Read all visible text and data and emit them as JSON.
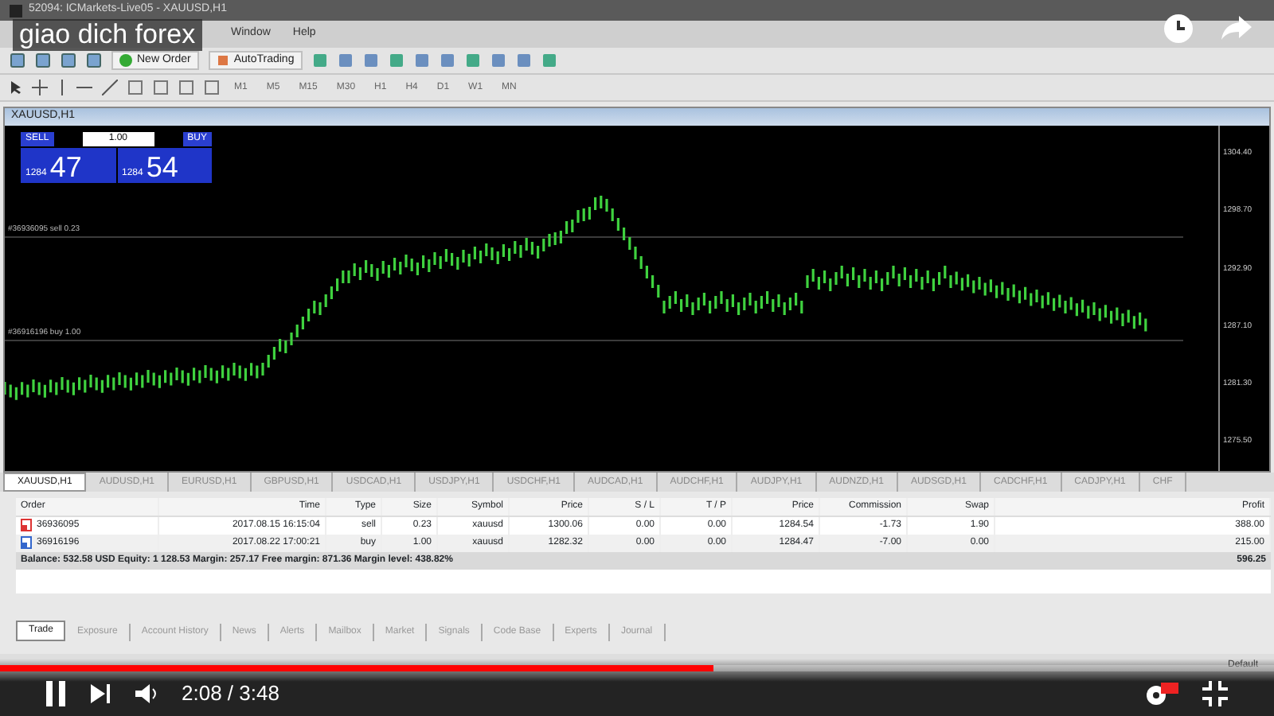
{
  "video": {
    "title": "giao dich forex",
    "progress": {
      "level": 0.56
    },
    "time": "2:08 / 3:48"
  },
  "window": {
    "title": "52094: ICMarkets-Live05 - XAUUSD,H1"
  },
  "menu": [
    "Window",
    "Help"
  ],
  "toolbar": {
    "buttons": [
      {
        "label": "New Order"
      },
      {
        "label": "AutoTrading"
      }
    ],
    "timeframes": [
      "M1",
      "M5",
      "M15",
      "M30",
      "H1",
      "H4",
      "D1",
      "W1",
      "MN"
    ]
  },
  "chart": {
    "title": "XAUUSD,H1",
    "one_click": {
      "sell": "SELL",
      "buy": "BUY",
      "volume": "1.00",
      "bid_big": "1284",
      "bid_small": "47",
      "ask_big": "1284",
      "ask_small": "54"
    },
    "order_lines": [
      "#36936095 sell 0.23",
      "#36916196 buy 1.00"
    ],
    "price_axis": [
      "1304.40",
      "1298.70",
      "1292.90",
      "1287.10",
      "1281.30",
      "1275.50"
    ]
  },
  "symbol_tabs": [
    {
      "label": "XAUUSD,H1",
      "selected": true
    },
    {
      "label": "AUDUSD,H1",
      "selected": false
    },
    {
      "label": "EURUSD,H1",
      "selected": false
    },
    {
      "label": "GBPUSD,H1",
      "selected": false
    },
    {
      "label": "USDCAD,H1",
      "selected": false
    },
    {
      "label": "USDJPY,H1",
      "selected": false
    },
    {
      "label": "USDCHF,H1",
      "selected": false
    },
    {
      "label": "AUDCAD,H1",
      "selected": false
    },
    {
      "label": "AUDCHF,H1",
      "selected": false
    },
    {
      "label": "AUDJPY,H1",
      "selected": false
    },
    {
      "label": "AUDNZD,H1",
      "selected": false
    },
    {
      "label": "AUDSGD,H1",
      "selected": false
    },
    {
      "label": "CADCHF,H1",
      "selected": false
    },
    {
      "label": "CADJPY,H1",
      "selected": false
    },
    {
      "label": "CHF",
      "selected": false
    }
  ],
  "table": {
    "columns": [
      "Order",
      "Time",
      "Type",
      "Size",
      "Symbol",
      "Price",
      "S / L",
      "T / P",
      "Price",
      "Commission",
      "Swap",
      "Profit"
    ],
    "rows": [
      {
        "kind": "sell",
        "cells": [
          "36936095",
          "2017.08.15 16:15:04",
          "sell",
          "0.23",
          "xauusd",
          "1300.06",
          "0.00",
          "0.00",
          "1284.54",
          "-1.73",
          "1.90",
          "388.00"
        ]
      },
      {
        "kind": "buy",
        "cells": [
          "36916196",
          "2017.08.22 17:00:21",
          "buy",
          "1.00",
          "xauusd",
          "1282.32",
          "0.00",
          "0.00",
          "1284.47",
          "-7.00",
          "0.00",
          "215.00"
        ]
      }
    ],
    "summary": {
      "text": "Balance: 532.58 USD  Equity: 1 128.53  Margin: 257.17  Free margin: 871.36  Margin level: 438.82%",
      "total": "596.25"
    }
  },
  "terminal_tabs": [
    {
      "label": "Trade",
      "selected": true
    },
    {
      "label": "Exposure",
      "selected": false
    },
    {
      "label": "Account History",
      "selected": false
    },
    {
      "label": "News",
      "selected": false
    },
    {
      "label": "Alerts",
      "selected": false
    },
    {
      "label": "Mailbox",
      "selected": false
    },
    {
      "label": "Market",
      "selected": false
    },
    {
      "label": "Signals",
      "selected": false
    },
    {
      "label": "Code Base",
      "selected": false
    },
    {
      "label": "Experts",
      "selected": false
    },
    {
      "label": "Journal",
      "selected": false
    }
  ],
  "status_bar": {
    "profile": "Default"
  }
}
